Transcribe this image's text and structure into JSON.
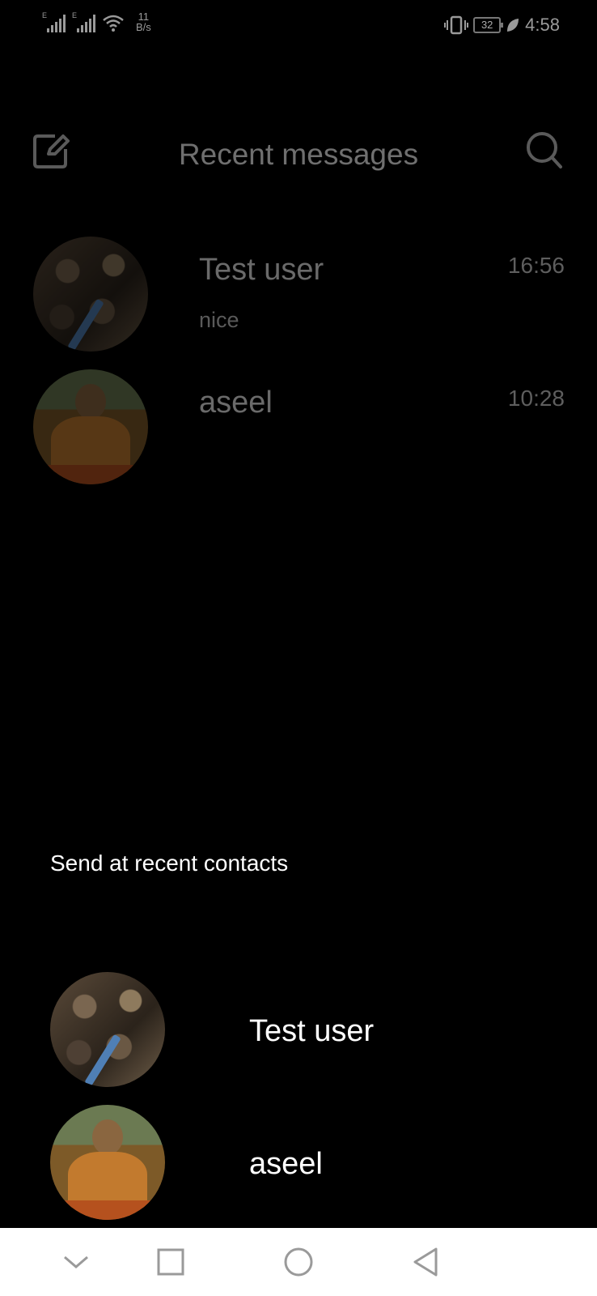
{
  "status_bar": {
    "network_1": "E",
    "network_2": "E",
    "speed_value": "11",
    "speed_unit": "B/s",
    "battery": "32",
    "time": "4:58",
    "icons": [
      "signal-icon",
      "signal-icon",
      "wifi-icon",
      "vibrate-icon",
      "battery-icon",
      "leaf-icon"
    ]
  },
  "header": {
    "title": "Recent messages",
    "compose_icon": "compose-icon",
    "search_icon": "search-icon"
  },
  "conversations": [
    {
      "name": "Test user",
      "time": "16:56",
      "preview": "nice"
    },
    {
      "name": "aseel",
      "time": "10:28",
      "preview": ""
    }
  ],
  "send_section": {
    "label": "Send at recent contacts",
    "contacts": [
      {
        "name": "Test user"
      },
      {
        "name": "aseel"
      }
    ]
  },
  "nav_bar": {
    "icons": [
      "chevron-down-icon",
      "recents-icon",
      "home-icon",
      "back-icon"
    ]
  },
  "colors": {
    "background": "#000000",
    "nav_background": "#ffffff",
    "dimmed_text": "#6a6a6a",
    "foreground_text": "#ffffff"
  }
}
